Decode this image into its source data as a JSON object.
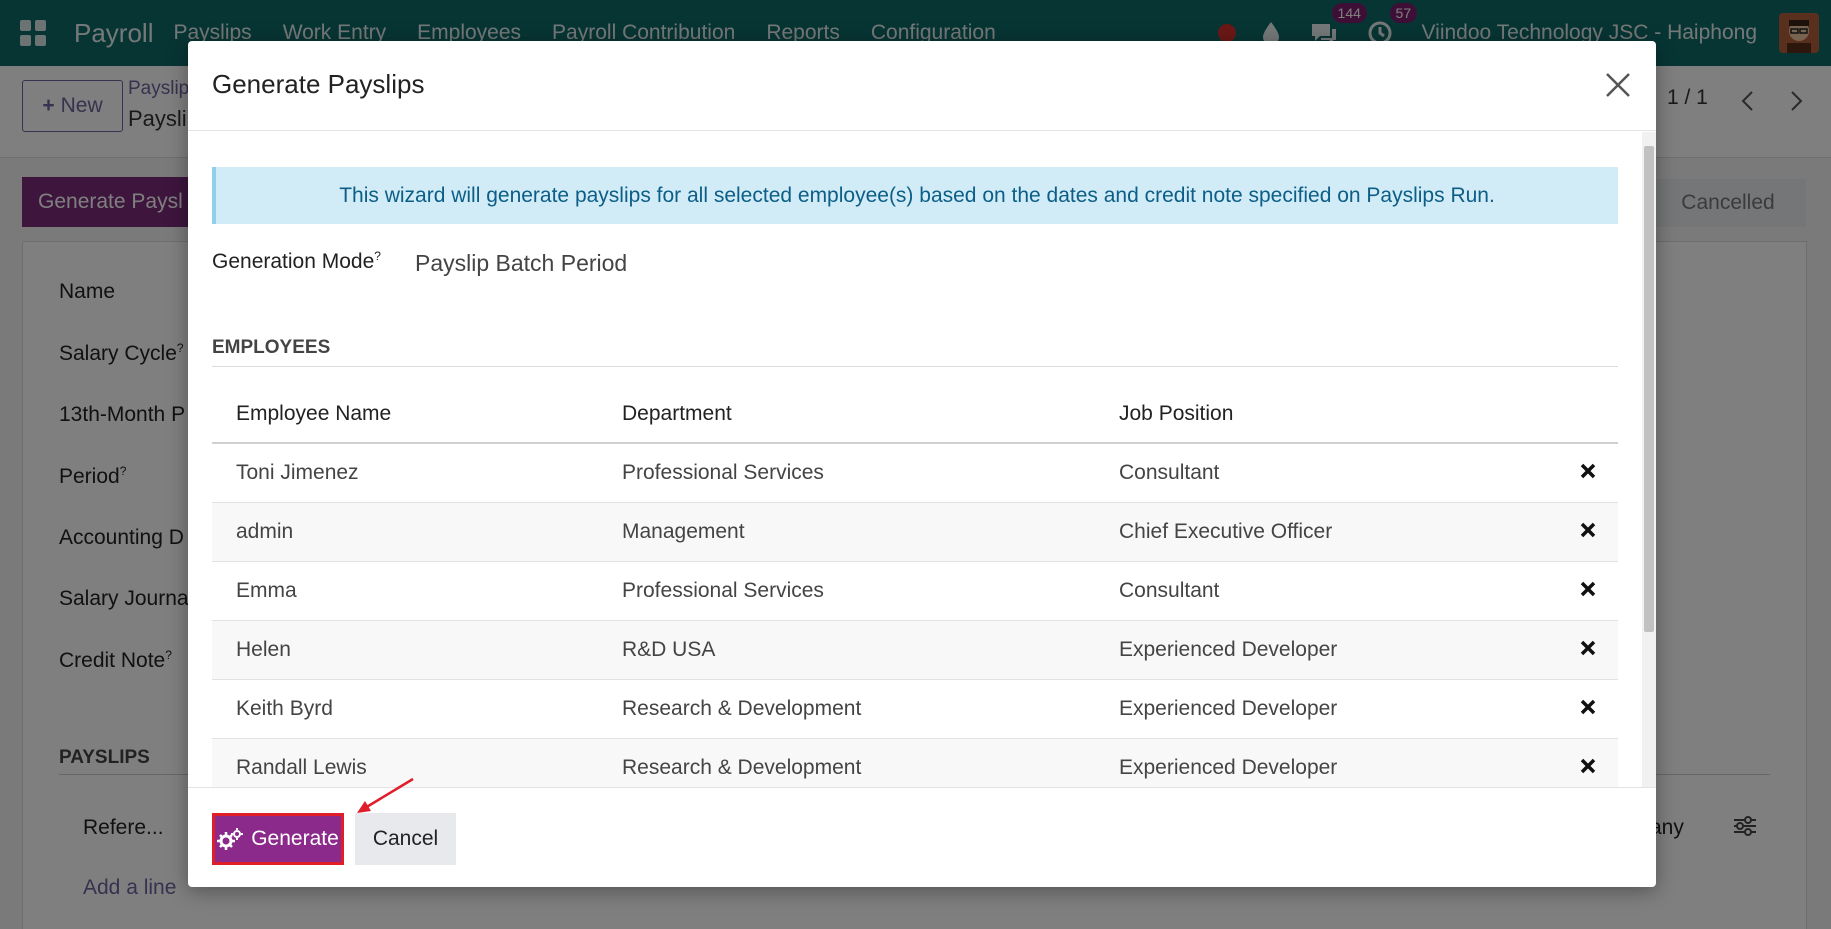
{
  "navbar": {
    "app_name": "Payroll",
    "menu": [
      "Payslips",
      "Work Entry",
      "Employees",
      "Payroll Contribution",
      "Reports",
      "Configuration"
    ],
    "messages_badge": "144",
    "activities_badge": "57",
    "company": "Viindoo Technology JSC - Haiphong"
  },
  "control_panel": {
    "new_label": "New",
    "breadcrumb_parent": "Payslip",
    "breadcrumb_current": "Paysli",
    "pager": "1 / 1"
  },
  "background_form": {
    "generate_button": "Generate Paysl",
    "status_cancelled": "Cancelled",
    "labels": {
      "name": "Name",
      "salary_cycle": "Salary Cycle",
      "thirteenth": "13th-Month P",
      "period": "Period",
      "accounting": "Accounting D",
      "salary_journal": "Salary Journa",
      "credit_note": "Credit Note"
    },
    "help_mark": "?",
    "payslips_heading": "PAYSLIPS",
    "ref_col": "Refere...",
    "company_col": "any",
    "add_line": "Add a line"
  },
  "modal": {
    "title": "Generate Payslips",
    "alert": "This wizard will generate payslips for all selected employee(s) based on the dates and credit note specified on Payslips Run.",
    "generation_mode_label": "Generation Mode",
    "help_mark": "?",
    "generation_mode_value": "Payslip Batch Period",
    "employees_heading": "EMPLOYEES",
    "columns": {
      "name": "Employee Name",
      "department": "Department",
      "job": "Job Position"
    },
    "rows": [
      {
        "name": "Toni Jimenez",
        "department": "Professional Services",
        "job": "Consultant"
      },
      {
        "name": "admin",
        "department": "Management",
        "job": "Chief Executive Officer"
      },
      {
        "name": "Emma",
        "department": "Professional Services",
        "job": "Consultant"
      },
      {
        "name": "Helen",
        "department": "R&D USA",
        "job": "Experienced Developer"
      },
      {
        "name": "Keith Byrd",
        "department": "Research & Development",
        "job": "Experienced Developer"
      },
      {
        "name": "Randall Lewis",
        "department": "Research & Development",
        "job": "Experienced Developer"
      }
    ],
    "generate_label": "Generate",
    "cancel_label": "Cancel"
  },
  "colors": {
    "navbar": "#0f6b69",
    "primary": "#8b2a8b",
    "highlight": "#e01e2a",
    "alert_bg": "#d1ecf7"
  },
  "icons": [
    "apps-icon",
    "drop-icon",
    "chat-icon",
    "clock-icon",
    "close-icon",
    "delete-icon",
    "gears-icon",
    "settings-icon",
    "chevron-left-icon",
    "chevron-right-icon"
  ]
}
